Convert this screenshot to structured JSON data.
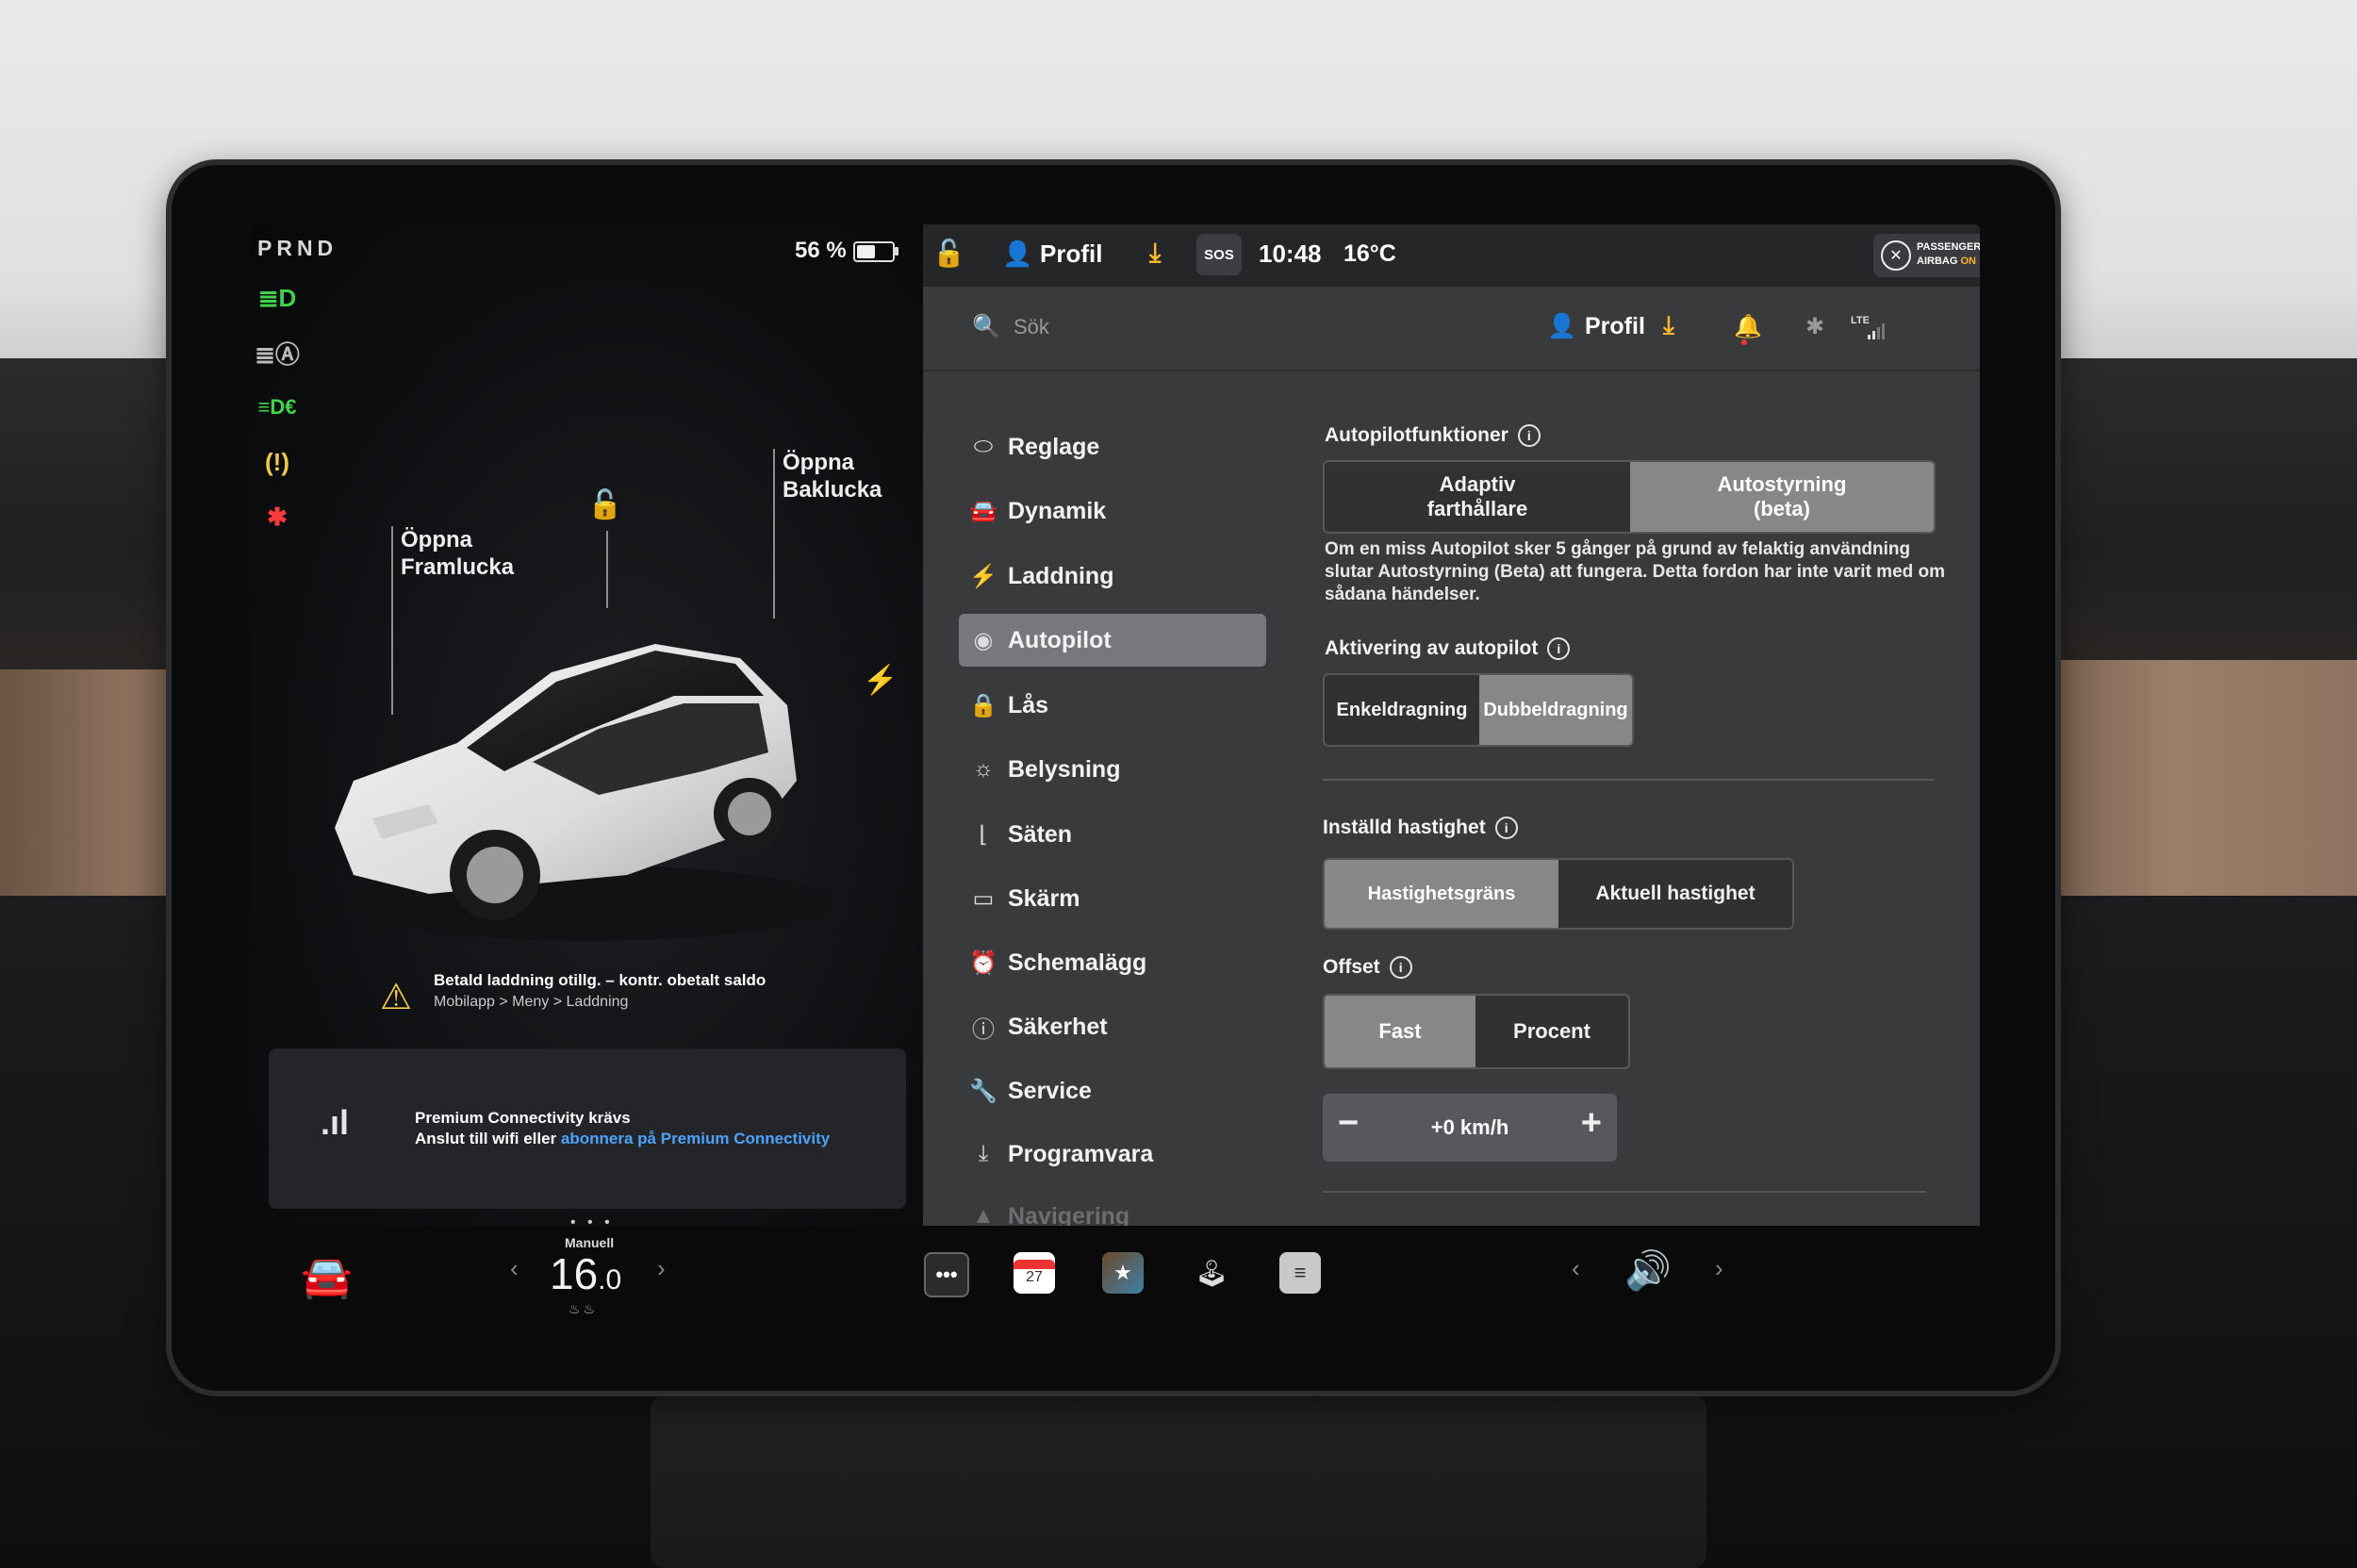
{
  "left_panel": {
    "gear": "PRND",
    "battery_percent": "56 %",
    "battery_level": 0.56,
    "indicators": [
      {
        "name": "low-beam-icon",
        "glyph": "≣D",
        "color": "#3fd24a"
      },
      {
        "name": "auto-high-beam-icon",
        "glyph": "≣Ⓐ",
        "color": "#bbbbbb"
      },
      {
        "name": "fog-lights-icon",
        "glyph": "≡D€",
        "color": "#3fd24a"
      },
      {
        "name": "tire-pressure-warning-icon",
        "glyph": "(!)",
        "color": "#f2c94c"
      },
      {
        "name": "seatbelt-warning-icon",
        "glyph": "✱",
        "color": "#ff3b3b"
      }
    ],
    "callout_frunk": [
      "Öppna",
      "Framlucka"
    ],
    "callout_trunk": [
      "Öppna",
      "Baklucka"
    ],
    "warning": {
      "line1": "Betald laddning otillg. – kontr. obetalt saldo",
      "line2": "Mobilapp > Meny > Laddning"
    },
    "connectivity": {
      "title": "Premium Connectivity krävs",
      "text_prefix": "Anslut till wifi eller ",
      "link": "abonnera på Premium Connectivity"
    },
    "page_dots": "• • •"
  },
  "status_bar": {
    "profile": "Profil",
    "sos": "SOS",
    "time": "10:48",
    "temperature": "16°C",
    "airbag_line1": "PASSENGER",
    "airbag_line2": "AIRBAG",
    "airbag_state": "ON"
  },
  "settings_header": {
    "search_placeholder": "Sök",
    "profile": "Profil",
    "lte": "LTE"
  },
  "nav": {
    "items": [
      {
        "label": "Reglage",
        "icon": "toggle-icon",
        "glyph": "⬭"
      },
      {
        "label": "Dynamik",
        "icon": "car-icon",
        "glyph": "🚘"
      },
      {
        "label": "Laddning",
        "icon": "bolt-icon",
        "glyph": "⚡"
      },
      {
        "label": "Autopilot",
        "icon": "steering-wheel-icon",
        "glyph": "◉",
        "active": true
      },
      {
        "label": "Lås",
        "icon": "lock-icon",
        "glyph": "🔒"
      },
      {
        "label": "Belysning",
        "icon": "sun-icon",
        "glyph": "☼"
      },
      {
        "label": "Säten",
        "icon": "seat-icon",
        "glyph": "⌊"
      },
      {
        "label": "Skärm",
        "icon": "display-icon",
        "glyph": "▭"
      },
      {
        "label": "Schemalägg",
        "icon": "clock-icon",
        "glyph": "⏰"
      },
      {
        "label": "Säkerhet",
        "icon": "info-circle-icon",
        "glyph": "ⓘ"
      },
      {
        "label": "Service",
        "icon": "wrench-icon",
        "glyph": "🔧"
      },
      {
        "label": "Programvara",
        "icon": "download-icon",
        "glyph": "⤓"
      },
      {
        "label": "Navigering",
        "icon": "navigation-icon",
        "glyph": "▲",
        "faded": true
      }
    ]
  },
  "autopilot": {
    "features_title": "Autopilotfunktioner",
    "features_options": [
      {
        "line1": "Adaptiv",
        "line2": "farthållare",
        "selected": false
      },
      {
        "line1": "Autostyrning",
        "line2": "(beta)",
        "selected": true
      }
    ],
    "description": "Om en miss Autopilot sker 5 gånger på grund av felaktig användning slutar Autostyrning (Beta) att fungera. Detta fordon har inte varit med om sådana händelser.",
    "activation_title": "Aktivering av autopilot",
    "activation_options": [
      {
        "label": "Enkeldragning",
        "selected": false
      },
      {
        "label": "Dubbeldragning",
        "selected": true
      }
    ],
    "speed_title": "Inställd hastighet",
    "speed_options": [
      {
        "label": "Hastighetsgräns",
        "selected": true
      },
      {
        "label": "Aktuell hastighet",
        "selected": false
      }
    ],
    "offset_title": "Offset",
    "offset_options": [
      {
        "label": "Fast",
        "selected": true
      },
      {
        "label": "Procent",
        "selected": false
      }
    ],
    "offset_value": "+0 km/h",
    "minus": "−",
    "plus": "+"
  },
  "dock": {
    "temp_mode": "Manuell",
    "temp_whole": "16",
    "temp_decimal": ".0",
    "calendar_day": "27",
    "arrow_left": "‹",
    "arrow_right": "›"
  }
}
